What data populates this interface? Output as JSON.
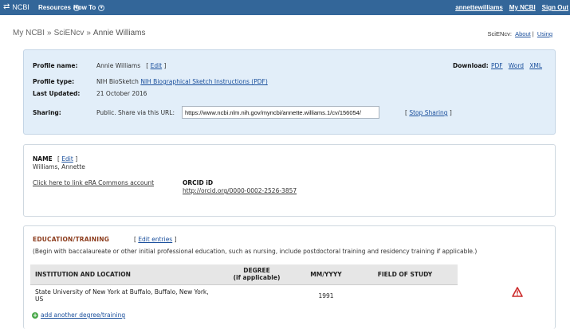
{
  "topbar": {
    "logo": "NCBI",
    "menu": [
      {
        "label": "Resources"
      },
      {
        "label": "How To"
      }
    ],
    "user": "annettewilliams",
    "my_ncbi": "My NCBI",
    "sign_out": "Sign Out"
  },
  "breadcrumb": {
    "home": "My NCBI",
    "section": "SciENcv",
    "current": "Annie Williams",
    "sep": "»"
  },
  "scilinks": {
    "label": "SciENcv:",
    "about": "About",
    "sep": "|",
    "using": "Using"
  },
  "profile": {
    "name_label": "Profile name:",
    "name_value": "Annie Williams",
    "edit": "Edit",
    "type_label": "Profile type:",
    "type_value": "NIH BioSketch",
    "type_link": "NIH Biographical Sketch Instructions (PDF)",
    "updated_label": "Last Updated:",
    "updated_value": "21 October 2016",
    "sharing_label": "Sharing:",
    "sharing_text": "Public. Share via this URL:",
    "sharing_url": "https://www.ncbi.nlm.nih.gov/myncbi/annette.williams.1/cv/156054/",
    "stop_sharing": "Stop Sharing",
    "download_label": "Download:",
    "download_pdf": "PDF",
    "download_word": "Word",
    "download_xml": "XML"
  },
  "name_section": {
    "title": "NAME",
    "edit": "Edit",
    "value": "Williams, Annette",
    "era_link": "Click here to link eRA Commons account",
    "orcid_label": "ORCID iD",
    "orcid_url": "http://orcid.org/0000-0002-2526-3857"
  },
  "education": {
    "title": "EDUCATION/TRAINING",
    "edit_entries": "Edit entries",
    "instructions": "(Begin with baccalaureate or other initial professional education, such as nursing, include postdoctoral training and residency training if applicable.)",
    "columns": {
      "institution": "INSTITUTION AND LOCATION",
      "degree_line1": "DEGREE",
      "degree_line2": "(if applicable)",
      "date": "MM/YYYY",
      "field": "FIELD OF STUDY"
    },
    "rows": [
      {
        "institution": "State University of New York at Buffalo, Buffalo, New York, US",
        "degree": "",
        "date": "1991",
        "field": ""
      }
    ],
    "add_link": "add another degree/training",
    "warning_color": "#cc2a2a"
  }
}
